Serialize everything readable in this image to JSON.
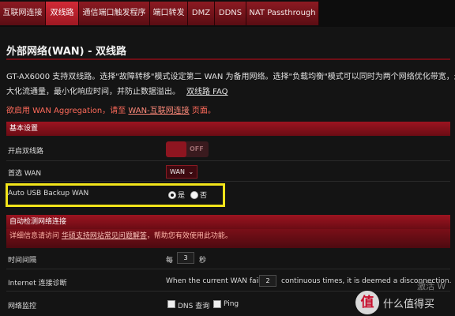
{
  "tabs": [
    "互联网连接",
    "双线路",
    "通信端口触发程序",
    "端口转发",
    "DMZ",
    "DDNS",
    "NAT Passthrough"
  ],
  "active_tab": "双线路",
  "page_title": "外部网络(WAN) - 双线路",
  "description": {
    "line1": "GT-AX6000 支持双线路。选择\"故障转移\"模式设定第二 WAN 为备用网络。选择\"负载均衡\"模式可以同时为两个网络优化带宽，最",
    "line2": "大化流通量，最小化响应时间，并防止数据溢出。",
    "faq_link": "双线路 FAQ"
  },
  "warning": {
    "prefix": "欲启用 WAN Aggregation，请至 ",
    "link": "WAN-互联网连接",
    "suffix": " 页面。"
  },
  "basic_settings": {
    "header": "基本设置",
    "enable_label": "开启双线路",
    "enable_toggle": "OFF",
    "primary_wan_label": "首选 WAN",
    "primary_wan_value": "WAN",
    "auto_usb_label": "Auto USB Backup WAN",
    "radio_yes": "是",
    "radio_no": "否",
    "radio_selected": "是"
  },
  "auto_detect": {
    "header": "自动检测网络连接",
    "note_prefix": "详细信息请访问 ",
    "note_link": "华硕支持网站常见问题解答",
    "note_suffix": "，帮助您有效使用此功能。",
    "interval_label": "时间间隔",
    "interval_prefix": "每",
    "interval_value": "3",
    "interval_unit": "秒",
    "diag_label": "Internet 连接诊断",
    "diag_prefix": "When the current WAN fails",
    "diag_value": "2",
    "diag_suffix": "continuous times, it is deemed a disconnection.",
    "monitor_label": "网络监控",
    "dns_check": "DNS 查询",
    "ping_check": "Ping"
  },
  "watermark": {
    "text1": "激活 W",
    "badge": "值",
    "text2": "什么值得买"
  },
  "colors": {
    "accent": "#9e1822",
    "highlight_box": "#f2e41a",
    "warning_text": "#ff6a5a"
  }
}
